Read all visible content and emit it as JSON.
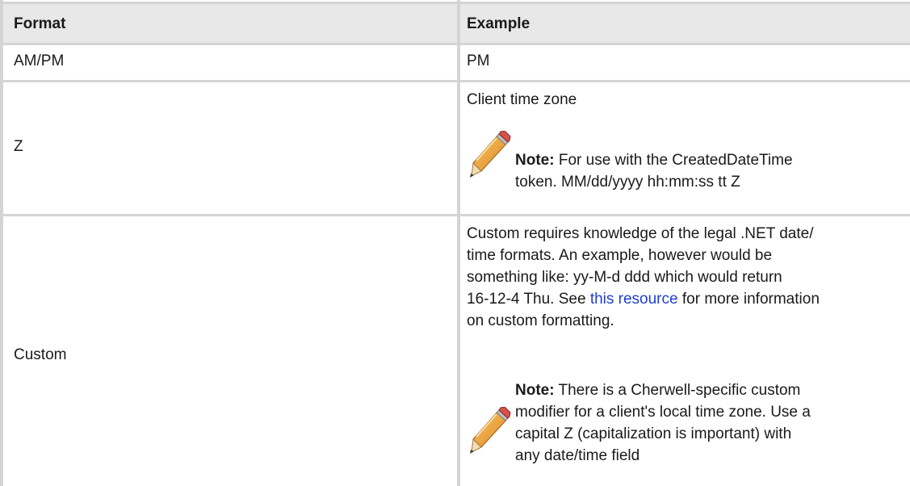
{
  "table": {
    "headers": {
      "format": "Format",
      "example": "Example"
    },
    "rows": [
      {
        "format": "AM/PM",
        "example": "PM"
      },
      {
        "format": "Z",
        "example": "Client time zone",
        "note_label": "Note:",
        "note_lines": [
          "For use with the CreatedDateTime",
          "token. MM/dd/yyyy hh:mm:ss tt Z"
        ],
        "note_icon": "pencil-icon"
      },
      {
        "format": "Custom",
        "example_lines": {
          "line1": "Custom requires knowledge of the legal .NET date/",
          "line2": "time formats. An example, however would be",
          "line3": "something like: yy-M-d ddd which would return",
          "line4_before": "16-12-4 Thu. See ",
          "line4_link": "this resource",
          "line4_after": " for more information",
          "line5": "on custom formatting."
        },
        "note_label": "Note:",
        "note_lines": [
          "There is a Cherwell-specific custom",
          "modifier for a client's local time zone. Use a",
          "capital Z (capitalization is important) with",
          "any date/time field"
        ],
        "note_icon": "pencil-icon"
      }
    ]
  },
  "colors": {
    "grid": "#d4d4d4",
    "header_bg": "#e8e8e8",
    "link": "#1f3fd1",
    "text": "#1a1a1a"
  }
}
